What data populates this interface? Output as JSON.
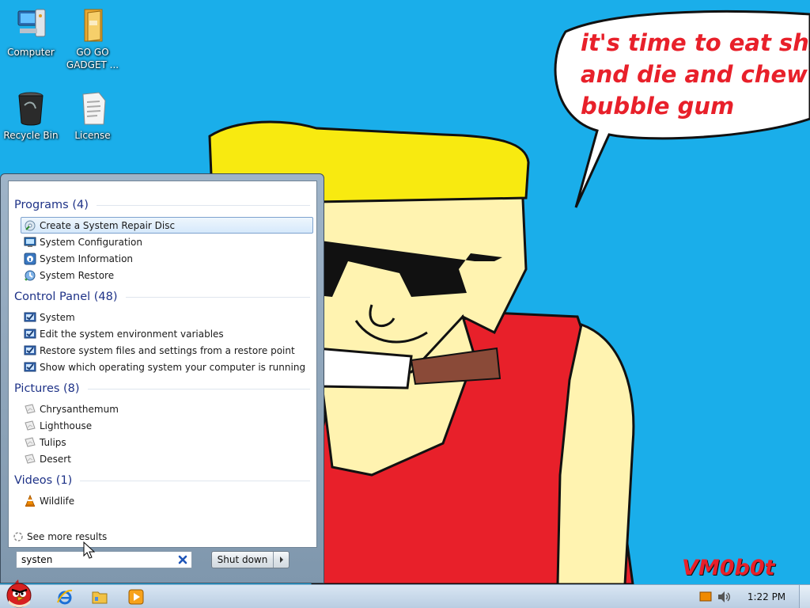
{
  "desktop": {
    "icons": [
      {
        "label": "Computer",
        "icon": "computer-icon"
      },
      {
        "label": "GO GO GADGET ...",
        "icon": "folder-icon"
      },
      {
        "label": "Recycle Bin",
        "icon": "recycle-bin-icon"
      },
      {
        "label": "License",
        "icon": "document-icon"
      }
    ],
    "wallpaper": {
      "speech_bubble": [
        "it's time to eat shit",
        "and die and chew",
        "bubble gum"
      ],
      "signature": "VM0b0t"
    }
  },
  "start_menu": {
    "groups": [
      {
        "title": "Programs (4)",
        "items": [
          {
            "label": "Create a System Repair Disc",
            "icon": "repair-disc-icon",
            "selected": true
          },
          {
            "label": "System Configuration",
            "icon": "system-config-icon"
          },
          {
            "label": "System Information",
            "icon": "system-info-icon"
          },
          {
            "label": "System Restore",
            "icon": "system-restore-icon"
          }
        ]
      },
      {
        "title": "Control Panel (48)",
        "items": [
          {
            "label": "System",
            "icon": "control-panel-icon"
          },
          {
            "label": "Edit the system environment variables",
            "icon": "control-panel-icon"
          },
          {
            "label": "Restore system files and settings from a restore point",
            "icon": "control-panel-icon"
          },
          {
            "label": "Show which operating system your computer is running",
            "icon": "control-panel-icon"
          }
        ]
      },
      {
        "title": "Pictures (8)",
        "items": [
          {
            "label": "Chrysanthemum",
            "icon": "picture-file-icon"
          },
          {
            "label": "Lighthouse",
            "icon": "picture-file-icon"
          },
          {
            "label": "Tulips",
            "icon": "picture-file-icon"
          },
          {
            "label": "Desert",
            "icon": "picture-file-icon"
          }
        ]
      },
      {
        "title": "Videos (1)",
        "items": [
          {
            "label": "Wildlife",
            "icon": "vlc-cone-icon"
          }
        ]
      }
    ],
    "see_more": "See more results",
    "search": {
      "value": "systen",
      "placeholder": ""
    },
    "shutdown_label": "Shut down"
  },
  "taskbar": {
    "start_icon": "angry-bird-icon",
    "pinned": [
      "internet-explorer-icon",
      "windows-explorer-icon",
      "media-player-icon"
    ],
    "tray": [
      "action-center-flag-icon",
      "volume-icon"
    ],
    "clock": "1:22 PM"
  }
}
